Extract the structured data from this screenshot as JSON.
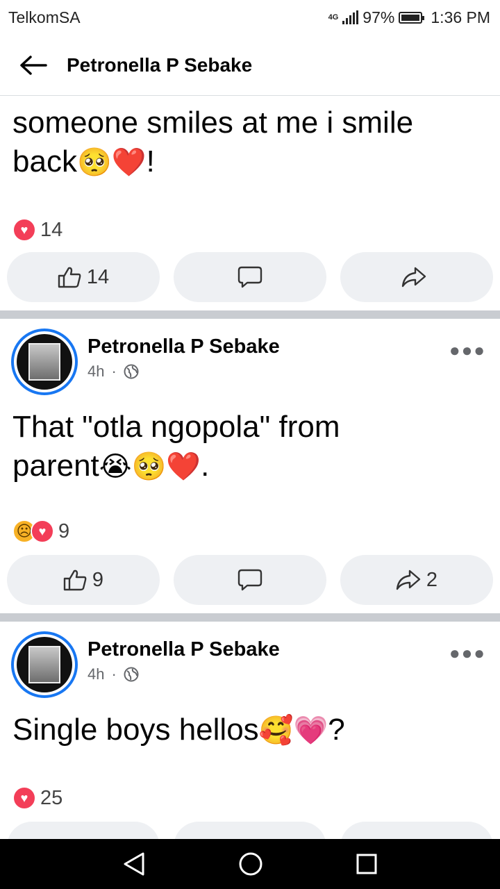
{
  "status_bar": {
    "carrier": "TelkomSA",
    "network": "4G",
    "battery_percent": "97%",
    "time": "1:36 PM",
    "battery_level": 0.97
  },
  "header": {
    "title": "Petronella P Sebake"
  },
  "posts": [
    {
      "text_line1": "someone smiles at me i smile",
      "text_line2": "back",
      "text_end": "!",
      "emojis": [
        "🥺",
        "❤️"
      ],
      "reaction_count": "14",
      "like_count": "14",
      "share_count": ""
    },
    {
      "author": "Petronella P Sebake",
      "time": "4h",
      "dot": "·",
      "text_line1": "That \"otla ngopola\" from",
      "text_line2": "parent",
      "text_end": ".",
      "emojis": [
        "😭",
        "🥺",
        "❤️"
      ],
      "reaction_count": "9",
      "like_count": "9",
      "share_count": "2"
    },
    {
      "author": "Petronella P Sebake",
      "time": "4h",
      "dot": "·",
      "text_line1": "Single boys hellos",
      "text_end": "?",
      "emojis": [
        "🥰",
        "💗"
      ],
      "reaction_count": "25"
    }
  ],
  "icons": {
    "back": "arrow-left-icon",
    "like": "thumbs-up-icon",
    "comment": "comment-icon",
    "share": "share-icon",
    "globe": "globe-icon",
    "more": "more-icon",
    "nav_back": "nav-back-icon",
    "nav_home": "nav-home-icon",
    "nav_recent": "nav-recent-icon"
  },
  "colors": {
    "accent": "#1877f2",
    "heart": "#f33e58",
    "button_bg": "#eef0f3",
    "separator": "#c9ccd1"
  }
}
